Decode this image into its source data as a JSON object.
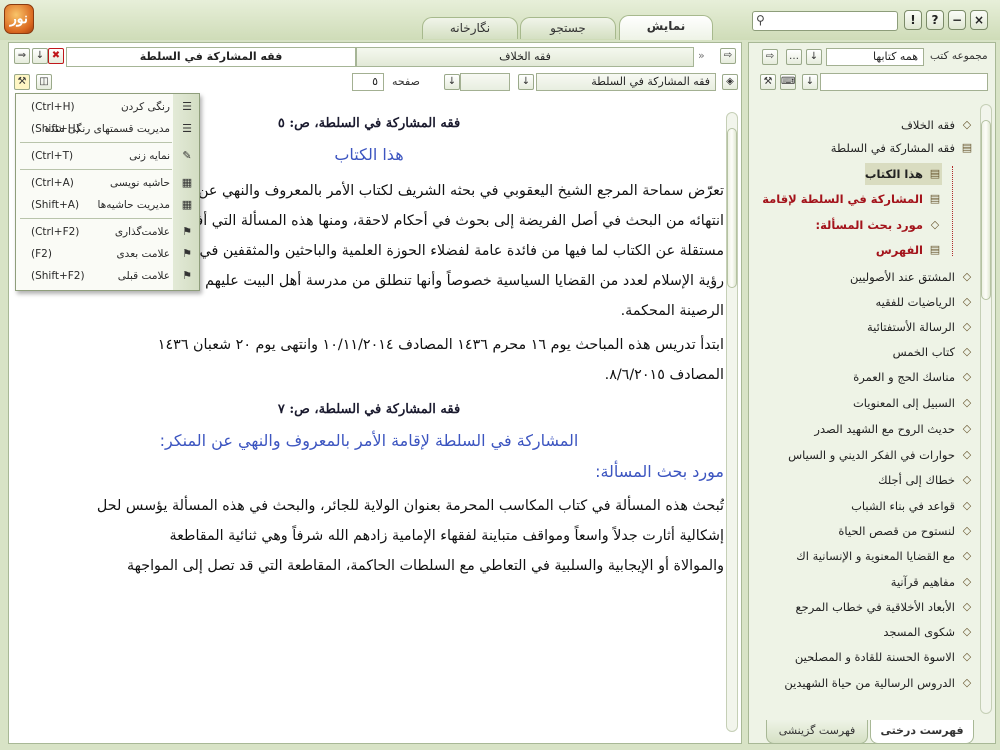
{
  "app": {
    "logo_text": "نور",
    "tabs": [
      {
        "label": "نمایش",
        "active": true
      },
      {
        "label": "جستجو",
        "active": false
      },
      {
        "label": "نگارخانه",
        "active": false
      }
    ],
    "window_buttons": [
      "!",
      "?",
      "−",
      "×"
    ]
  },
  "doc_toolbar": {
    "tabs": [
      {
        "label": "فقه المشاركة في السلطة",
        "active": true
      },
      {
        "label": "فقه الخلاف",
        "active": false
      }
    ],
    "page_label": "صفحه",
    "page_value": "٥",
    "book_selector_value": "فقه المشاركة في السلطة"
  },
  "menu": {
    "items": [
      {
        "label": "رنگی کردن",
        "shortcut": "(Ctrl+H)",
        "icon": "highlight-icon"
      },
      {
        "label": "مدیریت قسمتهای رنگی شده",
        "shortcut": "(Shift+H)",
        "icon": "manage-highlights-icon"
      },
      {
        "label": "نمایه زنی",
        "shortcut": "(Ctrl+T)",
        "icon": "index-icon"
      },
      {
        "label": "حاشیه نویسی",
        "shortcut": "(Ctrl+A)",
        "icon": "note-icon"
      },
      {
        "label": "مدیریت حاشیه‌ها",
        "shortcut": "(Shift+A)",
        "icon": "manage-notes-icon"
      },
      {
        "label": "علامت‌گذاری",
        "shortcut": "(Ctrl+F2)",
        "icon": "bookmark-icon"
      },
      {
        "label": "علامت بعدی",
        "shortcut": "(F2)",
        "icon": "next-bookmark-icon"
      },
      {
        "label": "علامت قبلی",
        "shortcut": "(Shift+F2)",
        "icon": "prev-bookmark-icon"
      }
    ]
  },
  "content": {
    "h1": "فقه المشاركة في السلطة، ص: ٥",
    "sub1": "هذا الكتاب",
    "p1_lines": [
      "تعرّض سماحة المرجع الشيخ اليعقوبي في بحثه الشريف لكتاب الأمر بالمعروف والنهي عن المنكر بعد",
      "انتهائه من البحث في أصل الفريضة إلى بحوث في أحكام لاحقة، ومنها هذه المسألة التي أفرد لها رسالة",
      "مستقلة عن الكتاب لما فيها من فائدة عامة لفضلاء الحوزة العلمية والباحثين والمثقفين في تعميق",
      "رؤية الإسلام لعدد من القضايا السياسية خصوصاً وأنها تنطلق من مدرسة أهل البيت عليهم السلام",
      "الرصينة المحكمة."
    ],
    "p2_lines": [
      "ابتدأ تدريس هذه المباحث يوم ١٦ محرم ١٤٣٦ المصادف ١٠/١١/٢٠١٤ وانتهى يوم ٢٠ شعبان ١٤٣٦",
      "المصادف ٨/٦/٢٠١٥."
    ],
    "h2": "فقه المشاركة في السلطة، ص: ٧",
    "sub2": "المشاركة في السلطة لإقامة الأمر بالمعروف والنهي عن المنكر:",
    "sub3": "مورد بحث المسألة:",
    "p3_lines": [
      "تُبحث هذه المسألة في كتاب المكاسب المحرمة بعنوان الولاية للجائر، والبحث في هذه المسألة يؤسس لحل",
      "إشكالية أثارت جدلاً واسعاً ومواقف متباينة لفقهاء الإمامية زادهم الله شرفاً وهي ثنائية المقاطعة",
      "والموالاة أو الإيجابية والسلبية في التعاطي مع السلطات الحاكمة، المقاطعة التي قد تصل إلى المواجهة"
    ]
  },
  "right_panel": {
    "collection_label": "مجموعه کتب",
    "collection_value": "همه کتابها",
    "tree": [
      {
        "label": "فقه الخلاف",
        "style": "normal",
        "icon": "book-icon"
      },
      {
        "label": "فقه المشاركة في السلطة",
        "style": "normal",
        "icon": "open-book-icon"
      },
      {
        "label": "هذا الكتاب",
        "style": "sel",
        "icon": "page-icon"
      },
      {
        "label": "المشاركة في السلطة لإقامة الأ",
        "style": "red",
        "icon": "page-icon"
      },
      {
        "label": "مورد بحث المسألة:",
        "style": "red",
        "icon": "book-icon"
      },
      {
        "label": "الفهرس",
        "style": "red",
        "icon": "page-icon"
      },
      {
        "label": "المشتق عند الأصوليين",
        "style": "normal",
        "icon": "book-icon"
      },
      {
        "label": "الرياضيات للفقيه",
        "style": "normal",
        "icon": "book-icon"
      },
      {
        "label": "الرسالة الأستفتائية",
        "style": "normal",
        "icon": "book-icon"
      },
      {
        "label": "كتاب الخمس",
        "style": "normal",
        "icon": "book-icon"
      },
      {
        "label": "مناسك الحج و العمرة",
        "style": "normal",
        "icon": "book-icon"
      },
      {
        "label": "السبيل إلى المعنويات",
        "style": "normal",
        "icon": "book-icon"
      },
      {
        "label": "حديث الروح مع الشهيد الصدر",
        "style": "normal",
        "icon": "book-icon"
      },
      {
        "label": "حوارات في الفكر الديني و السياس",
        "style": "normal",
        "icon": "book-icon"
      },
      {
        "label": "خطاك إلى أجلك",
        "style": "normal",
        "icon": "book-icon"
      },
      {
        "label": "قواعد في بناء الشباب",
        "style": "normal",
        "icon": "book-icon"
      },
      {
        "label": "لنستوح من قصص الحياة",
        "style": "normal",
        "icon": "book-icon"
      },
      {
        "label": "مع القضايا المعنوية و الإنسانية اك",
        "style": "normal",
        "icon": "book-icon"
      },
      {
        "label": "مفاهيم قرآنية",
        "style": "normal",
        "icon": "book-icon"
      },
      {
        "label": "الأبعاد الأخلاقية في خطاب المرجع",
        "style": "normal",
        "icon": "book-icon"
      },
      {
        "label": "شكوى المسجد",
        "style": "normal",
        "icon": "book-icon"
      },
      {
        "label": "الاسوة الحسنة للقادة و المصلحين",
        "style": "normal",
        "icon": "book-icon"
      },
      {
        "label": "الدروس الرسالية من حياة الشهيدين",
        "style": "normal",
        "icon": "book-icon"
      }
    ],
    "bottom_tabs": [
      {
        "label": "فهرست درختی",
        "active": true
      },
      {
        "label": "فهرست گزینشی",
        "active": false
      }
    ]
  }
}
